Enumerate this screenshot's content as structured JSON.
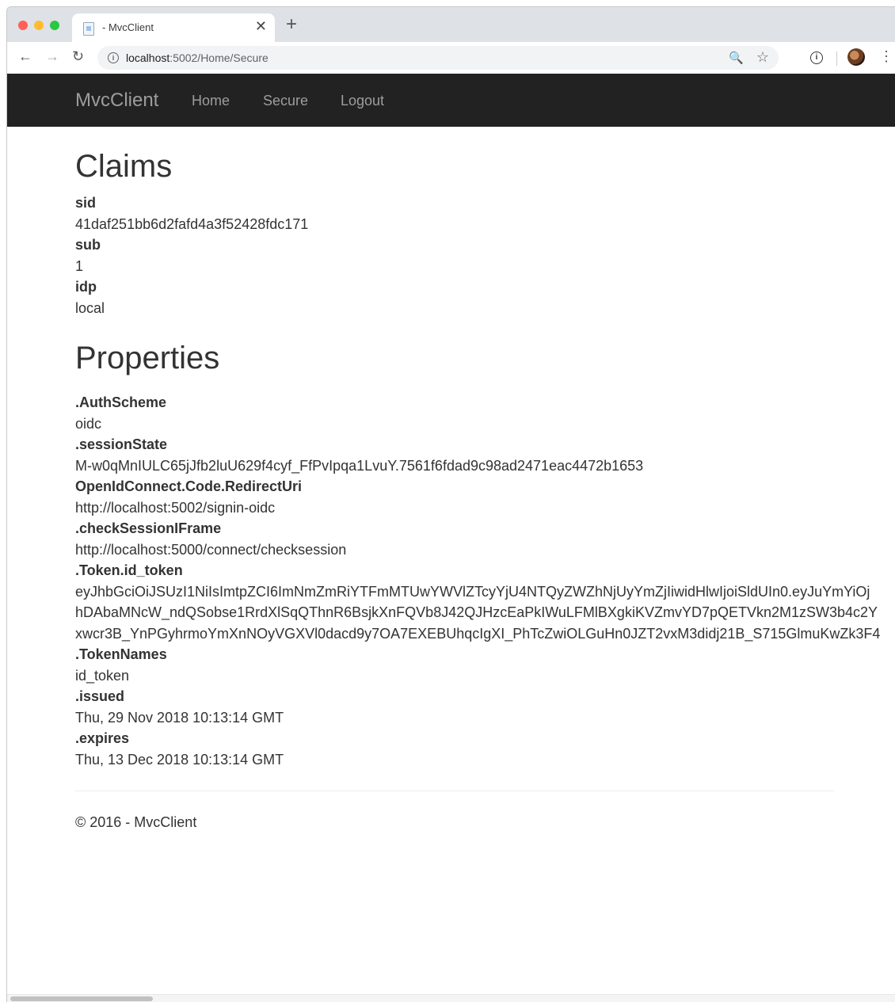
{
  "browser": {
    "tab_title": "- MvcClient",
    "tab_close": "✕",
    "new_tab": "+",
    "url_host": "localhost",
    "url_rest": ":5002/Home/Secure",
    "back": "←",
    "forward": "→",
    "reload": "↻",
    "zoom": "🔍",
    "star": "☆",
    "ext_label": "i",
    "menu": "⋮"
  },
  "navbar": {
    "brand": "MvcClient",
    "links": [
      "Home",
      "Secure",
      "Logout"
    ]
  },
  "claims": {
    "heading": "Claims",
    "items": [
      {
        "key": "sid",
        "value": "41daf251bb6d2fafd4a3f52428fdc171"
      },
      {
        "key": "sub",
        "value": "1"
      },
      {
        "key": "idp",
        "value": "local"
      }
    ]
  },
  "properties": {
    "heading": "Properties",
    "items": [
      {
        "key": ".AuthScheme",
        "value": "oidc"
      },
      {
        "key": ".sessionState",
        "value": "M-w0qMnIULC65jJfb2luU629f4cyf_FfPvIpqa1LvuY.7561f6fdad9c98ad2471eac4472b1653"
      },
      {
        "key": "OpenIdConnect.Code.RedirectUri",
        "value": "http://localhost:5002/signin-oidc"
      },
      {
        "key": ".checkSessionIFrame",
        "value": "http://localhost:5000/connect/checksession"
      },
      {
        "key": ".Token.id_token",
        "lines": [
          "eyJhbGciOiJSUzI1NiIsImtpZCI6ImNmZmRiYTFmMTUwYWVlZTcyYjU4NTQyZWZhNjUyYmZjIiwidHlwIjoiSldUIn0.eyJuYmYiOj",
          "hDAbaMNcW_ndQSobse1RrdXlSqQThnR6BsjkXnFQVb8J42QJHzcEaPkIWuLFMlBXgkiKVZmvYD7pQETVkn2M1zSW3b4c2Y",
          "xwcr3B_YnPGyhrmoYmXnNOyVGXVl0dacd9y7OA7EXEBUhqcIgXI_PhTcZwiOLGuHn0JZT2vxM3didj21B_S715GlmuKwZk3F4"
        ]
      },
      {
        "key": ".TokenNames",
        "value": "id_token"
      },
      {
        "key": ".issued",
        "value": "Thu, 29 Nov 2018 10:13:14 GMT"
      },
      {
        "key": ".expires",
        "value": "Thu, 13 Dec 2018 10:13:14 GMT"
      }
    ]
  },
  "footer": {
    "text": "© 2016 - MvcClient"
  }
}
